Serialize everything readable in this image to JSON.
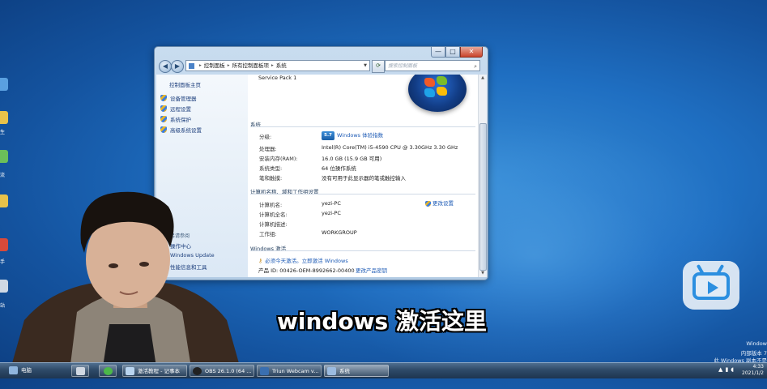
{
  "window": {
    "address": [
      "控制面板",
      "所有控制面板项",
      "系统"
    ],
    "search_placeholder": "搜索控制面板",
    "caption": {
      "min": "—",
      "max": "□",
      "close": "✕"
    }
  },
  "sidebar": {
    "home": "控制面板主页",
    "links": [
      "设备管理器",
      "远程设置",
      "系统保护",
      "高级系统设置"
    ],
    "see_also": "另请参阅",
    "bottom_links": [
      "操作中心",
      "Windows Update",
      "性能信息和工具"
    ]
  },
  "content": {
    "service_pack": "Service Pack 1",
    "system_section": "系统",
    "rating_label": "分级:",
    "rating_badge": "5.7",
    "rating_link": "Windows 体验指数",
    "processor_label": "处理器:",
    "processor_value": "Intel(R) Core(TM) i5-4590 CPU @ 3.30GHz   3.30 GHz",
    "ram_label": "安装内存(RAM):",
    "ram_value": "16.0 GB (15.9 GB 可用)",
    "type_label": "系统类型:",
    "type_value": "64 位操作系统",
    "pen_label": "笔和触摸:",
    "pen_value": "没有可用于此显示器的笔或触控输入",
    "computer_section": "计算机名称、域和工作组设置",
    "name_label": "计算机名:",
    "name_value": "yezi-PC",
    "change_settings": "更改设置",
    "fullname_label": "计算机全名:",
    "fullname_value": "yezi-PC",
    "desc_label": "计算机描述:",
    "desc_value": "",
    "workgroup_label": "工作组:",
    "workgroup_value": "WORKGROUP",
    "activation_section": "Windows 激活",
    "activation_link": "必须今天激活。立即激活 Windows",
    "product_id": "产品 ID: 00426-OEM-8992662-00400",
    "change_key": "更改产品密钥"
  },
  "overlay": {
    "subtitle": "windows 激活这里"
  },
  "desktop_watermark": {
    "line1": "Window",
    "line2": "内部版本 7",
    "line3": "此 Windows 副本不是"
  },
  "taskbar": {
    "items": [
      "电脑",
      "激活教程 - 记事本",
      "OBS 26.1.0 (64 ...",
      "Triun Webcam v...",
      "系统"
    ],
    "time": "4:33",
    "date": "2021/1/2"
  },
  "colors": {
    "link": "#1c5ab5",
    "bilibili": "#2c8fe0"
  }
}
